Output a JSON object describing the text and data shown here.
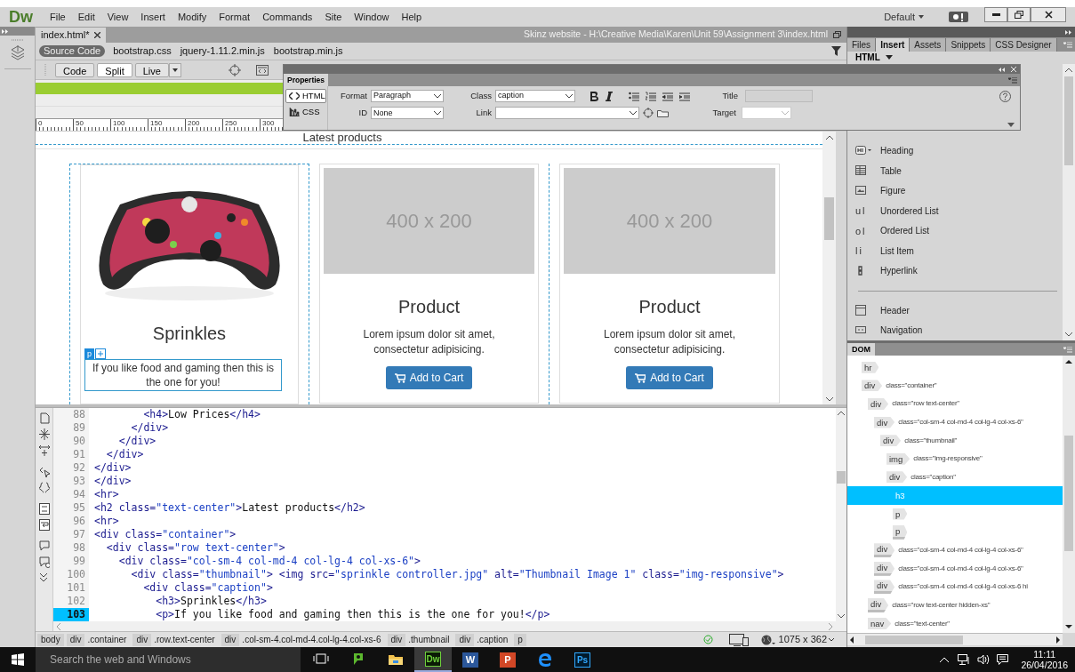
{
  "app": {
    "logo": "Dw",
    "menu": [
      "File",
      "Edit",
      "View",
      "Insert",
      "Modify",
      "Format",
      "Commands",
      "Site",
      "Window",
      "Help"
    ],
    "workspace": "Default"
  },
  "document": {
    "tab": "index.html*",
    "path": "Skinz website - H:\\Creative Media\\Karen\\Unit 59\\Assignment 3\\index.html",
    "related_files": [
      {
        "label": "Source Code",
        "selected": true
      },
      {
        "label": "bootstrap.css",
        "selected": false
      },
      {
        "label": "jquery-1.11.2.min.js",
        "selected": false
      },
      {
        "label": "bootstrap.min.js",
        "selected": false
      }
    ],
    "view_buttons": [
      {
        "label": "Code",
        "selected": false
      },
      {
        "label": "Split",
        "selected": true
      },
      {
        "label": "Live",
        "selected": false
      }
    ],
    "ruler_marks": [
      "0",
      "50",
      "100",
      "150",
      "200",
      "250",
      "300"
    ]
  },
  "properties": {
    "title": "Properties",
    "modes": [
      {
        "label": "HTML",
        "selected": true
      },
      {
        "label": "CSS",
        "selected": false
      }
    ],
    "format_label": "Format",
    "format": "Paragraph",
    "id_label": "ID",
    "id": "None",
    "class_label": "Class",
    "class": "caption",
    "link_label": "Link",
    "title_label": "Title",
    "target_label": "Target"
  },
  "design": {
    "heading": "Latest products",
    "cards": [
      {
        "title": "Sprinkles",
        "selection_tag": "p",
        "text": "If you like food and gaming then this is the one for you!"
      },
      {
        "kind": "placeholder",
        "image_label": "400 x 200",
        "title": "Product",
        "text": "Lorem ipsum dolor sit amet, consectetur adipisicing.",
        "button": "Add to Cart"
      },
      {
        "kind": "placeholder",
        "image_label": "400 x 200",
        "title": "Product",
        "text": "Lorem ipsum dolor sit amet, consectetur adipisicing.",
        "button": "Add to Cart"
      }
    ]
  },
  "code": {
    "lines": [
      {
        "number": "88",
        "code": "        <h4>Low Prices</h4>",
        "selected": false
      },
      {
        "number": "89",
        "code": "      </div>",
        "selected": false
      },
      {
        "number": "90",
        "code": "    </div>",
        "selected": false
      },
      {
        "number": "91",
        "code": "  </div>",
        "selected": false
      },
      {
        "number": "92",
        "code": "</div>",
        "selected": false
      },
      {
        "number": "93",
        "code": "</div>",
        "selected": false
      },
      {
        "number": "94",
        "code": "<hr>",
        "selected": false
      },
      {
        "number": "95",
        "code": "<h2 class=\"text-center\">Latest products</h2>",
        "selected": false
      },
      {
        "number": "96",
        "code": "<hr>",
        "selected": false
      },
      {
        "number": "97",
        "code": "<div class=\"container\">",
        "selected": false
      },
      {
        "number": "98",
        "code": "  <div class=\"row text-center\">",
        "selected": false
      },
      {
        "number": "99",
        "code": "    <div class=\"col-sm-4 col-md-4 col-lg-4 col-xs-6\">",
        "selected": false
      },
      {
        "number": "100",
        "code": "      <div class=\"thumbnail\"> <img src=\"sprinkle controller.jpg\" alt=\"Thumbnail Image 1\" class=\"img-responsive\">",
        "selected": false
      },
      {
        "number": "101",
        "code": "        <div class=\"caption\">",
        "selected": false
      },
      {
        "number": "102",
        "code": "          <h3>Sprinkles</h3>",
        "selected": false
      },
      {
        "number": "103",
        "code": "          <p>If you like food and gaming then this is the one for you!</p>",
        "selected": true
      }
    ]
  },
  "tag_selector": [
    {
      "tag": "body"
    },
    {
      "tag": "div",
      "class": ".container"
    },
    {
      "tag": "div",
      "class": ".row.text-center"
    },
    {
      "tag": "div",
      "class": ".col-sm-4.col-md-4.col-lg-4.col-xs-6"
    },
    {
      "tag": "div",
      "class": ".thumbnail"
    },
    {
      "tag": "div",
      "class": ".caption"
    },
    {
      "tag": "p"
    }
  ],
  "status": {
    "window_size": "1075 x 362"
  },
  "panel": {
    "tabs": [
      {
        "label": "Files",
        "selected": false
      },
      {
        "label": "Insert",
        "selected": true
      },
      {
        "label": "Assets",
        "selected": false
      },
      {
        "label": "Snippets",
        "selected": false
      },
      {
        "label": "CSS Designer",
        "selected": false
      }
    ],
    "category": "HTML",
    "items": [
      {
        "kind": "heading",
        "label": "Heading"
      },
      {
        "kind": "table",
        "label": "Table"
      },
      {
        "kind": "figure",
        "label": "Figure"
      },
      {
        "kind": "glyph",
        "glyph": "ul",
        "label": "Unordered List"
      },
      {
        "kind": "glyph",
        "glyph": "ol",
        "label": "Ordered List"
      },
      {
        "kind": "glyph",
        "glyph": "li",
        "label": "List Item"
      },
      {
        "kind": "link",
        "label": "Hyperlink"
      },
      {
        "kind": "divider"
      },
      {
        "kind": "header",
        "label": "Header"
      },
      {
        "kind": "nav",
        "label": "Navigation"
      }
    ]
  },
  "dom": {
    "title": "DOM",
    "tree": [
      {
        "tag": "hr",
        "expanded": true,
        "selected": false
      },
      {
        "tag": "div",
        "attr": "class=\"container\"",
        "expanded": true,
        "selected": false,
        "children": [
          {
            "tag": "div",
            "attr": "class=\"row text-center\"",
            "expanded": true,
            "selected": false,
            "children": [
              {
                "tag": "div",
                "attr": "class=\"col-sm-4 col-md-4 col-lg-4 col-xs-6\"",
                "expanded": true,
                "selected": false,
                "children": [
                  {
                    "tag": "div",
                    "attr": "class=\"thumbnail\"",
                    "expanded": true,
                    "selected": false,
                    "children": [
                      {
                        "tag": "img",
                        "attr": "class=\"img-responsive\"",
                        "expanded": true,
                        "selected": false
                      },
                      {
                        "tag": "div",
                        "attr": "class=\"caption\"",
                        "expanded": true,
                        "selected": false,
                        "children": [
                          {
                            "tag": "h3",
                            "expanded": true,
                            "selected": true
                          },
                          {
                            "tag": "p",
                            "expanded": true,
                            "selected": false
                          },
                          {
                            "tag": "p",
                            "expanded": false,
                            "selected": false
                          }
                        ]
                      }
                    ]
                  }
                ]
              },
              {
                "tag": "div",
                "attr": "class=\"col-sm-4 col-md-4 col-lg-4 col-xs-6\"",
                "expanded": false,
                "selected": false
              },
              {
                "tag": "div",
                "attr": "class=\"col-sm-4 col-md-4 col-lg-4 col-xs-6\"",
                "expanded": false,
                "selected": false
              },
              {
                "tag": "div",
                "attr": "class=\"col-sm-4 col-md-4 col-lg-4 col-xs-6 hi",
                "expanded": false,
                "selected": false
              }
            ]
          },
          {
            "tag": "div",
            "attr": "class=\"row text-center hidden-xs\"",
            "expanded": false,
            "selected": false
          },
          {
            "tag": "nav",
            "attr": "class=\"text-center\"",
            "expanded": true,
            "selected": false
          }
        ]
      }
    ]
  },
  "taskbar": {
    "search_placeholder": "Search the web and Windows",
    "apps": [
      {
        "kind": "taskview",
        "selected": false
      },
      {
        "kind": "chat",
        "selected": false
      },
      {
        "kind": "folder",
        "selected": false
      },
      {
        "kind": "dw",
        "label": "Dw",
        "selected": true
      },
      {
        "kind": "word",
        "label": "W",
        "selected": false
      },
      {
        "kind": "powerpoint",
        "label": "P",
        "selected": false
      },
      {
        "kind": "edge",
        "selected": false
      },
      {
        "kind": "ps",
        "label": "Ps",
        "selected": false
      }
    ],
    "time": "11:11",
    "date": "26/04/2016"
  }
}
